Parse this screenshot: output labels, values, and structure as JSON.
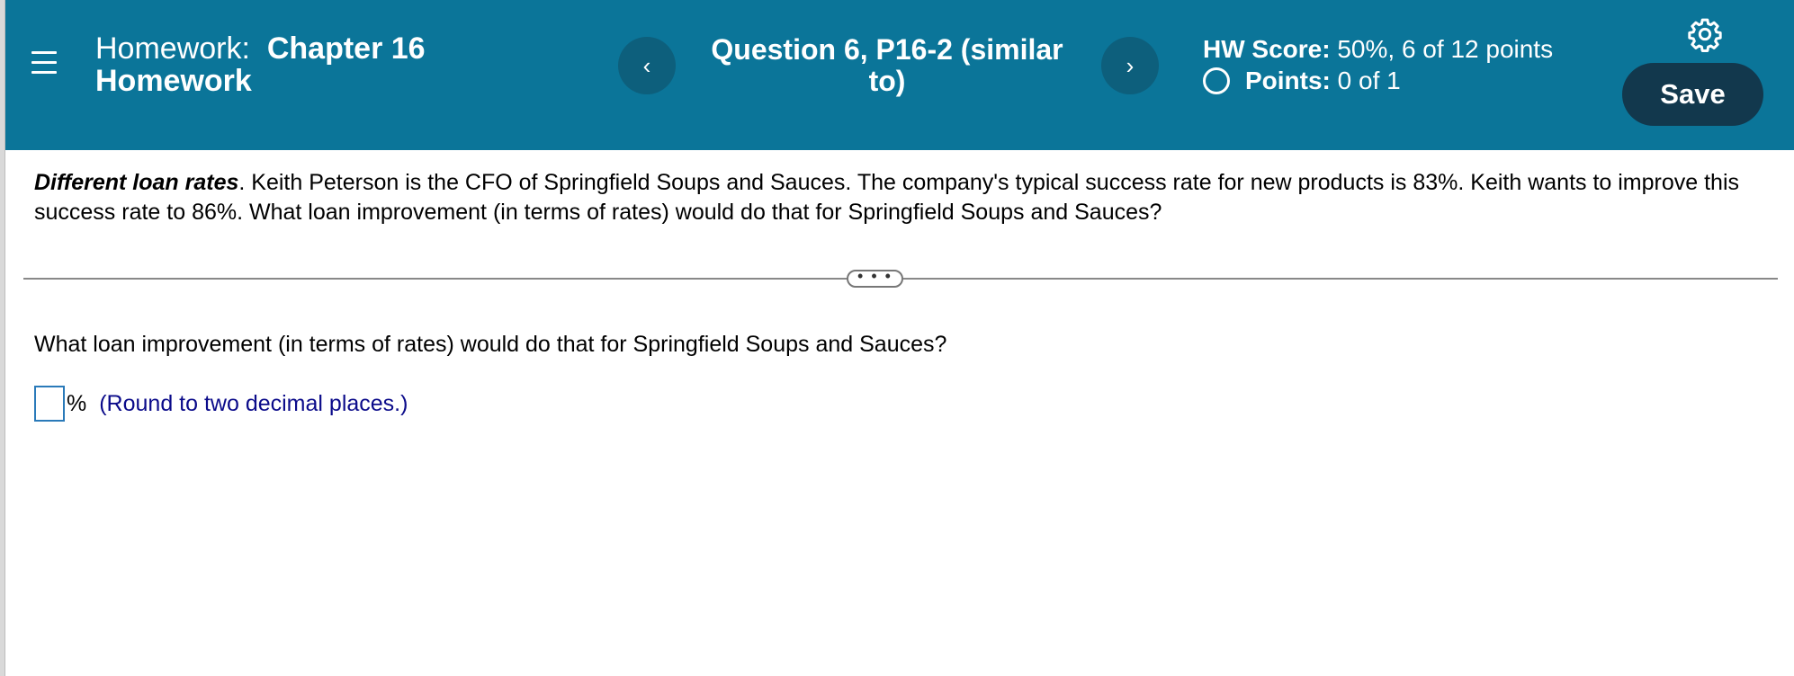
{
  "header": {
    "homework_prefix": "Homework:",
    "homework_title": "Chapter 16 Homework",
    "prev_label": "‹",
    "question_title": "Question 6, P16-2 (similar to)",
    "next_label": "›",
    "hw_score_label": "HW Score:",
    "hw_score_value": "50%, 6 of 12 points",
    "points_label": "Points:",
    "points_value": "0 of 1",
    "save_label": "Save",
    "icons": [
      "menu-icon",
      "gear-icon",
      "chevron-left-icon",
      "chevron-right-icon",
      "circle-icon"
    ]
  },
  "problem": {
    "lead": "Different loan rates",
    "text": ".  Keith Peterson is the CFO of Springfield Soups and Sauces.  The company's typical success rate for new products is 83%.  Keith wants to improve this success rate to 86%.  What loan improvement (in terms of rates) would do that for Springfield Soups and Sauces?"
  },
  "expand_label": "• • •",
  "question": {
    "text": "What loan improvement (in terms of rates) would do that for Springfield Soups and Sauces?",
    "answer_value": "",
    "unit": "%",
    "hint": "(Round to two decimal places.)"
  },
  "colors": {
    "header_bg": "#0b7599",
    "nav_button_bg": "#0d5f7c",
    "save_button_bg": "#12384d",
    "hint_text": "#0b0b8a"
  }
}
